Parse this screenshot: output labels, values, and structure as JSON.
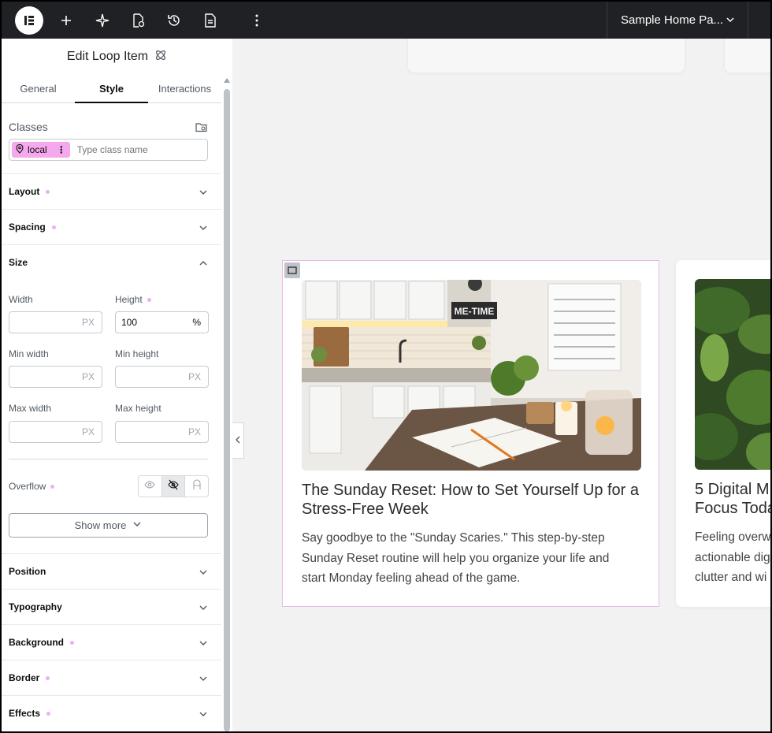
{
  "topbar": {
    "page_name": "Sample Home Pa...",
    "icons": [
      "elementor-logo-icon",
      "plus-icon",
      "ai-sparkle-icon",
      "page-settings-icon",
      "history-icon",
      "structure-icon",
      "more-vertical-icon",
      "chevron-down-icon"
    ]
  },
  "panel": {
    "title": "Edit Loop Item",
    "tabs": [
      "General",
      "Style",
      "Interactions"
    ],
    "active_tab": "Style",
    "classes": {
      "label": "Classes",
      "chip": "local",
      "placeholder": "Type class name"
    },
    "sections": {
      "layout": "Layout",
      "spacing": "Spacing",
      "size": "Size",
      "position": "Position",
      "typography": "Typography",
      "background": "Background",
      "border": "Border",
      "effects": "Effects"
    },
    "size": {
      "width": {
        "label": "Width",
        "value": "",
        "unit": "PX"
      },
      "height": {
        "label": "Height",
        "value": "100",
        "unit": "%"
      },
      "min_width": {
        "label": "Min width",
        "value": "",
        "unit": "PX"
      },
      "min_height": {
        "label": "Min height",
        "value": "",
        "unit": "PX"
      },
      "max_width": {
        "label": "Max width",
        "value": "",
        "unit": "PX"
      },
      "max_height": {
        "label": "Max height",
        "value": "",
        "unit": "PX"
      },
      "overflow_label": "Overflow",
      "overflow_selected": "hidden",
      "show_more": "Show more"
    },
    "accent_dot_color": "#f0abfc"
  },
  "canvas": {
    "card1": {
      "title": "The Sunday Reset: How to Set Yourself Up for a Stress-Free Week",
      "excerpt": "Say goodbye to the \"Sunday Scaries.\" This step-by-step Sunday Reset routine will help you organize your life and start Monday feeling ahead of the game.",
      "image_sign": "ME-TIME"
    },
    "card2": {
      "title_line1": "5 Digital M",
      "title_line2": "Focus Toda",
      "excerpt_line1": "Feeling overw",
      "excerpt_line2": "actionable dig",
      "excerpt_line3": "clutter and wi"
    }
  }
}
